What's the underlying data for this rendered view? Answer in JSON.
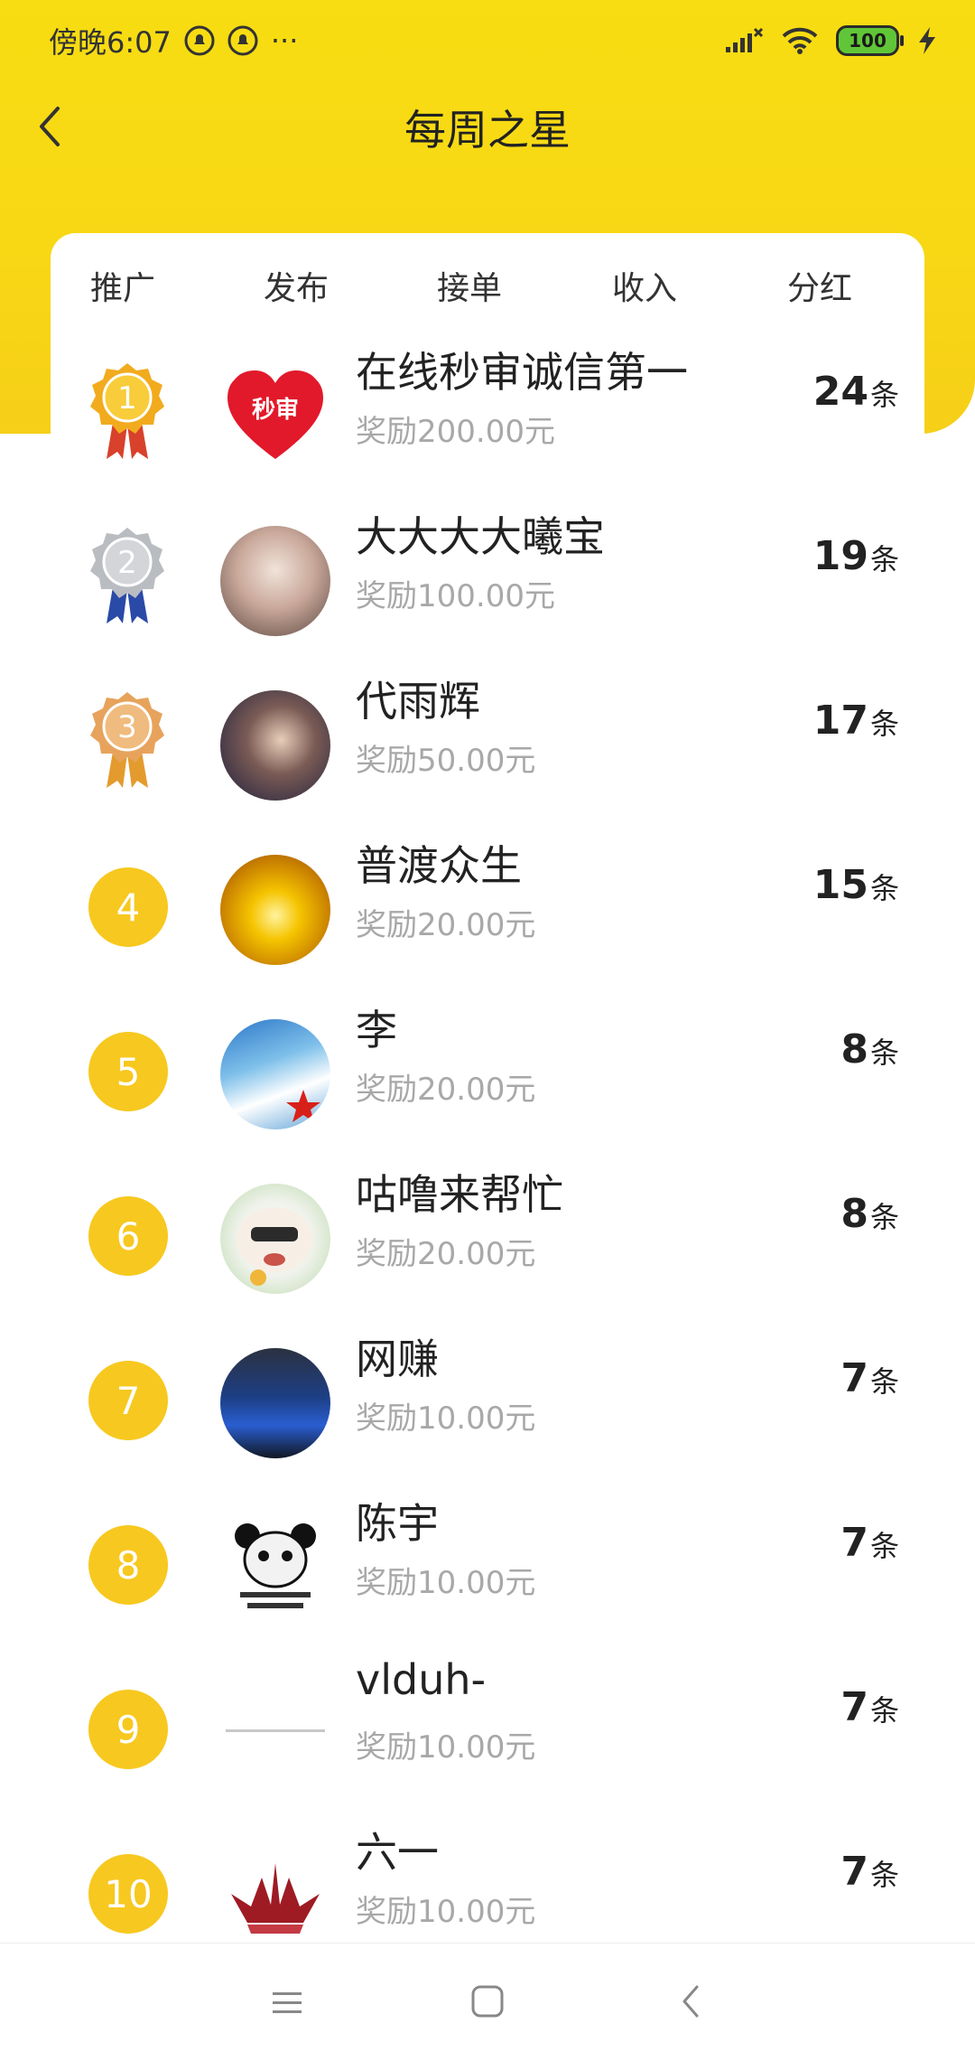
{
  "status_bar": {
    "time": "傍晚6:07",
    "more_dots": "···",
    "battery": "100"
  },
  "header": {
    "title": "每周之星"
  },
  "tabs": [
    {
      "label": "推广",
      "active": false
    },
    {
      "label": "发布",
      "active": true
    },
    {
      "label": "接单",
      "active": false
    },
    {
      "label": "收入",
      "active": false
    },
    {
      "label": "分红",
      "active": false
    }
  ],
  "ranking": [
    {
      "rank": "1",
      "medal": "gold-medal",
      "name": "在线秒审诚信第一",
      "reward": "奖励200.00元",
      "count": "24",
      "unit": "条",
      "avatar_text": "秒审"
    },
    {
      "rank": "2",
      "medal": "silver-medal",
      "name": "大大大大曦宝",
      "reward": "奖励100.00元",
      "count": "19",
      "unit": "条"
    },
    {
      "rank": "3",
      "medal": "bronze-medal",
      "name": "代雨辉",
      "reward": "奖励50.00元",
      "count": "17",
      "unit": "条"
    },
    {
      "rank": "4",
      "name": "普渡众生",
      "reward": "奖励20.00元",
      "count": "15",
      "unit": "条"
    },
    {
      "rank": "5",
      "name": "李",
      "reward": "奖励20.00元",
      "count": "8",
      "unit": "条"
    },
    {
      "rank": "6",
      "name": "咕噜来帮忙",
      "reward": "奖励20.00元",
      "count": "8",
      "unit": "条"
    },
    {
      "rank": "7",
      "name": "网赚",
      "reward": "奖励10.00元",
      "count": "7",
      "unit": "条"
    },
    {
      "rank": "8",
      "name": "陈宇",
      "reward": "奖励10.00元",
      "count": "7",
      "unit": "条"
    },
    {
      "rank": "9",
      "name": "vlduh-",
      "reward": "奖励10.00元",
      "count": "7",
      "unit": "条"
    },
    {
      "rank": "10",
      "name": "六一",
      "reward": "奖励10.00元",
      "count": "7",
      "unit": "条"
    }
  ],
  "colors": {
    "brand_yellow": "#f7dd12",
    "rank_circle": "#f7c81f",
    "reward_text": "#a8a8a8"
  }
}
